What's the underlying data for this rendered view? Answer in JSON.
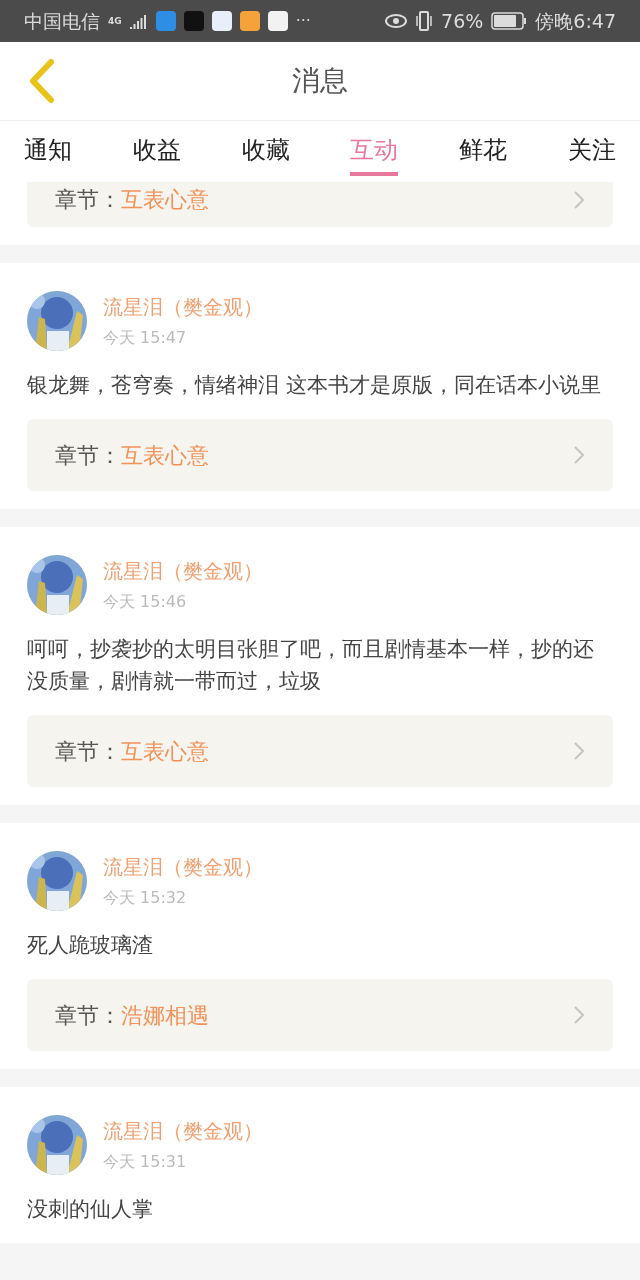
{
  "status_bar": {
    "carrier": "中国电信",
    "network": "4G",
    "more": "···",
    "battery": "76%",
    "time": "傍晚6:47"
  },
  "header": {
    "title": "消息"
  },
  "tabs": [
    {
      "label": "通知",
      "selected": false
    },
    {
      "label": "收益",
      "selected": false
    },
    {
      "label": "收藏",
      "selected": false
    },
    {
      "label": "互动",
      "selected": true
    },
    {
      "label": "鲜花",
      "selected": false
    },
    {
      "label": "关注",
      "selected": false
    }
  ],
  "partial_card": {
    "chapter_label": "章节：",
    "chapter": "互表心意"
  },
  "messages": [
    {
      "user": "流星泪（樊金观）",
      "time": "今天 15:47",
      "text": "银龙舞，苍穹奏，情绪神泪 这本书才是原版，同在话本小说里",
      "chapter_label": "章节：",
      "chapter": "互表心意"
    },
    {
      "user": "流星泪（樊金观）",
      "time": "今天 15:46",
      "text": "呵呵，抄袭抄的太明目张胆了吧，而且剧情基本一样，抄的还没质量，剧情就一带而过，垃圾",
      "chapter_label": "章节：",
      "chapter": "互表心意"
    },
    {
      "user": "流星泪（樊金观）",
      "time": "今天 15:32",
      "text": "死人跪玻璃渣",
      "chapter_label": "章节：",
      "chapter": "浩娜相遇"
    },
    {
      "user": "流星泪（樊金观）",
      "time": "今天 15:31",
      "text": "没刺的仙人掌"
    }
  ]
}
